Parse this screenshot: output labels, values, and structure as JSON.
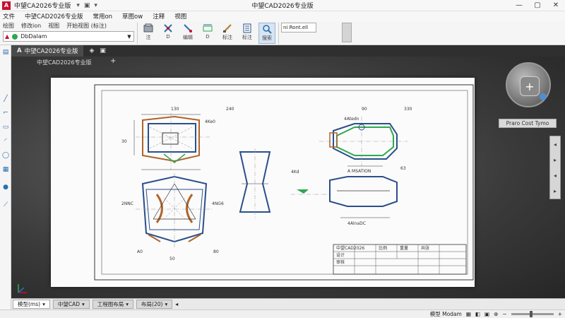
{
  "window": {
    "app_name": "中望CA2026专业版",
    "title": "中望CAD2026专业版",
    "minimize": "—",
    "maximize": "▢",
    "close": "✕"
  },
  "quick_access": [
    "▾",
    "▣",
    "▾"
  ],
  "menubar": {
    "items": [
      "文件",
      "中望CAD2026专业版",
      "常用on",
      "草图ow",
      "注释",
      "视图"
    ]
  },
  "ribbon": {
    "row1_items": [
      "绘图",
      "修改ion",
      "视图",
      "开始视图 (标注)"
    ],
    "layer_combo_value": "DbDaIam",
    "tools": [
      {
        "label": "注",
        "icon": "layer-icon"
      },
      {
        "label": "D",
        "icon": "move-icon"
      },
      {
        "label": "编辑",
        "icon": "edit-icon"
      },
      {
        "label": "D",
        "icon": "dimension-icon"
      },
      {
        "label": "标注",
        "icon": "annotate-icon"
      },
      {
        "label": "标注",
        "icon": "table-icon"
      },
      {
        "label": "搜索",
        "icon": "search-icon"
      }
    ],
    "search_placeholder": "ni Ront.ell"
  },
  "drawing_tab": {
    "label": "中望CA2026专业版",
    "file_label": "中望CAD2026专业版"
  },
  "nav": {
    "coord_button": "Praro Cost Tymo"
  },
  "drawing": {
    "dims_top": [
      "130",
      "240",
      "90",
      "330"
    ],
    "dims_left_view": [
      "30",
      "4Ke0",
      "4Kd",
      "2NNC",
      "4NG6"
    ],
    "dims_right_view": [
      "63",
      "4Atedn",
      "4AlnaDC"
    ],
    "bottom_dims": [
      "A0",
      "50",
      "80"
    ],
    "note": "A MSATION",
    "title_block": [
      "中望CAD2026",
      "设计",
      "审核",
      "比例",
      "重量",
      "共张"
    ]
  },
  "layout_tabs": [
    {
      "label": "模型(ms)",
      "active": true
    },
    {
      "label": "中望CAD",
      "active": false
    },
    {
      "label": "工程图布局",
      "active": false
    },
    {
      "label": "布局(20)",
      "active": false
    }
  ],
  "statusbar": {
    "left": "",
    "model_label": "模型 Modam"
  }
}
